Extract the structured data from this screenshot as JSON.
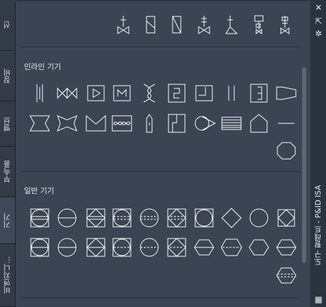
{
  "tabs": [
    {
      "label": "선"
    },
    {
      "label": "장비"
    },
    {
      "label": "밸브"
    },
    {
      "label": "부속품"
    },
    {
      "label": "기기"
    },
    {
      "label": "비엔지니..."
    }
  ],
  "sections": {
    "inline": {
      "title": "인라인 기기"
    },
    "general": {
      "title": "일반 기기"
    }
  },
  "palette": {
    "title": "도구 팔레트 - P&ID ISA",
    "close_glyph": "✕",
    "autohide_glyph": "⇱",
    "properties_glyph": "✲",
    "menu_glyph": "▦"
  },
  "icons": {
    "top_row": [
      "valve-actuator-icon",
      "valve-rect-icon",
      "valve-rect-diag-icon",
      "valve-weight-icon",
      "valve-angle-icon",
      "valve-solenoid-icon",
      "valve-diaphragm-icon"
    ],
    "inline_row1": [
      "bar-pipe-icon",
      "valve-double-icon",
      "meter-arrow-icon",
      "meter-m-icon",
      "venturi-icon",
      "meter-s-icon",
      "corner-box-icon",
      "double-line-icon",
      "bracket-box-icon",
      "reducer-icon"
    ],
    "inline_row2": [
      "nozzle-icon",
      "bowtie-icon",
      "wedge-icon",
      "wave-icon",
      "probe-icon",
      "step-box-icon",
      "pointer-circle-icon",
      "striped-box-icon",
      "house-icon",
      "line-icon",
      "octagon-icon"
    ],
    "general_row1": [
      "circle-square-icon",
      "circle-line-icon",
      "square-diamond-icon",
      "circle-square-dash-icon",
      "circle-dash-icon",
      "diamond-square-icon",
      "circle-in-square-icon",
      "diamond-icon",
      "circle-icon",
      "square-x-icon"
    ],
    "general_row2": [
      "circle-square-2-icon",
      "circle-line-2-icon",
      "square-diamond-2-icon",
      "circle-square-dash-2-icon",
      "circle-dash-2-icon",
      "diamond-square-2-icon",
      "hexagon-icon",
      "hexagon-wide-icon",
      "hexagon-2-icon",
      "hexagon-dash-icon",
      "hexagon-line-icon"
    ]
  }
}
